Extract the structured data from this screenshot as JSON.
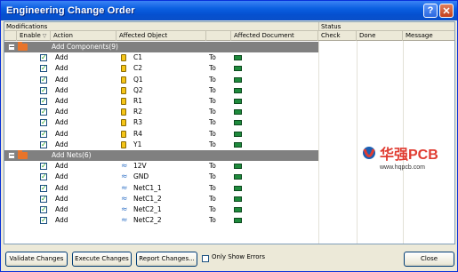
{
  "window": {
    "title": "Engineering Change Order"
  },
  "groups": {
    "modifications": "Modifications",
    "status": "Status"
  },
  "columns": {
    "enable": "Enable",
    "action": "Action",
    "affected_object": "Affected Object",
    "affected_document": "Affected Document",
    "check": "Check",
    "done": "Done",
    "message": "Message"
  },
  "sections": [
    {
      "label": "Add Components(9)",
      "icon": "folder-icon",
      "rows": [
        {
          "action": "Add",
          "object": "C1",
          "to": "To",
          "obj_icon": "component-icon"
        },
        {
          "action": "Add",
          "object": "C2",
          "to": "To",
          "obj_icon": "component-icon"
        },
        {
          "action": "Add",
          "object": "Q1",
          "to": "To",
          "obj_icon": "component-icon"
        },
        {
          "action": "Add",
          "object": "Q2",
          "to": "To",
          "obj_icon": "component-icon"
        },
        {
          "action": "Add",
          "object": "R1",
          "to": "To",
          "obj_icon": "component-icon"
        },
        {
          "action": "Add",
          "object": "R2",
          "to": "To",
          "obj_icon": "component-icon"
        },
        {
          "action": "Add",
          "object": "R3",
          "to": "To",
          "obj_icon": "component-icon"
        },
        {
          "action": "Add",
          "object": "R4",
          "to": "To",
          "obj_icon": "component-icon"
        },
        {
          "action": "Add",
          "object": "Y1",
          "to": "To",
          "obj_icon": "component-icon"
        }
      ]
    },
    {
      "label": "Add Nets(6)",
      "icon": "folder-icon",
      "rows": [
        {
          "action": "Add",
          "object": "12V",
          "to": "To",
          "obj_icon": "net-icon"
        },
        {
          "action": "Add",
          "object": "GND",
          "to": "To",
          "obj_icon": "net-icon"
        },
        {
          "action": "Add",
          "object": "NetC1_1",
          "to": "To",
          "obj_icon": "net-icon"
        },
        {
          "action": "Add",
          "object": "NetC1_2",
          "to": "To",
          "obj_icon": "net-icon"
        },
        {
          "action": "Add",
          "object": "NetC2_1",
          "to": "To",
          "obj_icon": "net-icon"
        },
        {
          "action": "Add",
          "object": "NetC2_2",
          "to": "To",
          "obj_icon": "net-icon"
        }
      ]
    }
  ],
  "buttons": {
    "validate": "Validate Changes",
    "execute": "Execute Changes",
    "report": "Report Changes...",
    "only_errors": "Only Show Errors",
    "close": "Close"
  },
  "watermark": {
    "brand": "华强PCB",
    "url": "www.hqpcb.com"
  },
  "colors": {
    "titlebar": "#0a5fe0",
    "group_row": "#808080",
    "doc_icon": "#1e8a3c"
  }
}
